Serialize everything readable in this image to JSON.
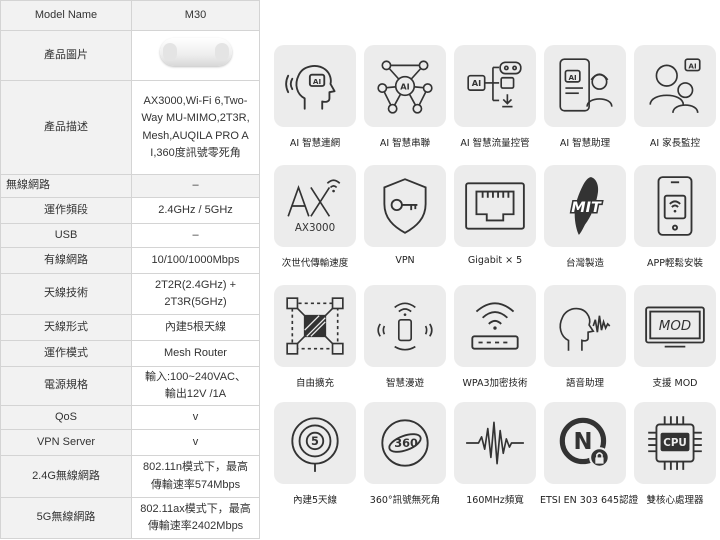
{
  "spec_table": {
    "header": {
      "label": "Model Name",
      "value": "M30"
    },
    "rows": [
      {
        "label": "產品圖片",
        "value": ""
      },
      {
        "label": "產品描述",
        "value": "AX3000,Wi-Fi 6,Two-Way MU-MIMO,2T3R,Mesh,AUQILA PRO AI,360度訊號零死角"
      },
      {
        "label": "無線網路",
        "value": "–"
      },
      {
        "label": "運作頻段",
        "value": "2.4GHz / 5GHz"
      },
      {
        "label": "USB",
        "value": "–"
      },
      {
        "label": "有線網路",
        "value": "10/100/1000Mbps"
      },
      {
        "label": "天線技術",
        "value": "2T2R(2.4GHz) + 2T3R(5GHz)"
      },
      {
        "label": "天線形式",
        "value": "內建5根天線"
      },
      {
        "label": "運作模式",
        "value": "Mesh Router"
      },
      {
        "label": "電源規格",
        "value": "輸入:100~240VAC、輸出12V /1A"
      },
      {
        "label": "QoS",
        "value": "v"
      },
      {
        "label": "VPN Server",
        "value": "v"
      },
      {
        "label": "2.4G無線網路",
        "value": "802.11n模式下，最高傳輸速率574Mbps"
      },
      {
        "label": "5G無線網路",
        "value": "802.11ax模式下，最高傳輸速率2402Mbps"
      }
    ]
  },
  "features": [
    {
      "icon": "ai-head-icon",
      "label": "AI 智慧連網"
    },
    {
      "icon": "ai-network-icon",
      "label": "AI 智慧串聯"
    },
    {
      "icon": "ai-traffic-icon",
      "label": "AI 智慧流量控管"
    },
    {
      "icon": "ai-assistant-icon",
      "label": "AI 智慧助理"
    },
    {
      "icon": "ai-parental-icon",
      "label": "AI 家長監控"
    },
    {
      "icon": "ax-wifi-icon",
      "label": "次世代傳輸速度",
      "icon_text": "AX3000"
    },
    {
      "icon": "vpn-shield-icon",
      "label": "VPN"
    },
    {
      "icon": "ethernet-port-icon",
      "label": "Gigabit × 5"
    },
    {
      "icon": "taiwan-map-icon",
      "label": "台灣製造",
      "icon_text": "MIT"
    },
    {
      "icon": "phone-app-icon",
      "label": "APP輕鬆安裝"
    },
    {
      "icon": "expand-nodes-icon",
      "label": "自由擴充"
    },
    {
      "icon": "roaming-icon",
      "label": "智慧漫遊"
    },
    {
      "icon": "wpa3-router-icon",
      "label": "WPA3加密技術"
    },
    {
      "icon": "voice-assistant-icon",
      "label": "語音助理"
    },
    {
      "icon": "mod-box-icon",
      "label": "支援 MOD",
      "icon_text": "MOD"
    },
    {
      "icon": "antenna-5-icon",
      "label": "內建5天線",
      "icon_text": "5"
    },
    {
      "icon": "360-signal-icon",
      "label": "360°訊號無死角",
      "icon_text": "360"
    },
    {
      "icon": "160mhz-wave-icon",
      "label": "160MHz頻寬"
    },
    {
      "icon": "etsi-cert-icon",
      "label": "ETSI EN 303 645認證",
      "icon_text": "N"
    },
    {
      "icon": "cpu-chip-icon",
      "label": "雙核心處理器",
      "icon_text": "CPU"
    }
  ],
  "colors": {
    "tile_bg": "#ececec",
    "icon_stroke": "#333333",
    "table_label_bg": "#f2f2f2",
    "table_border": "#d4d4d4"
  }
}
